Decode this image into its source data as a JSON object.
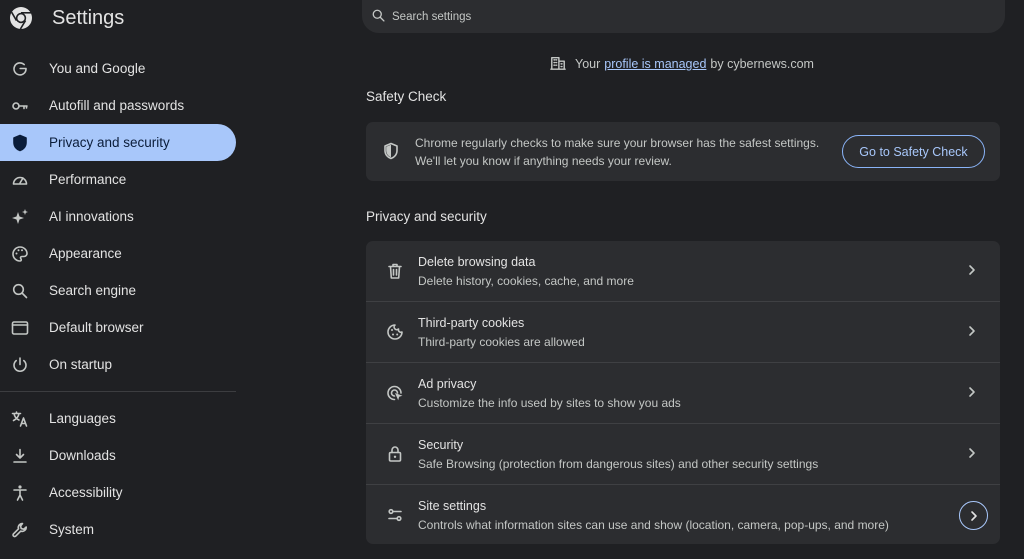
{
  "app": {
    "title": "Settings",
    "logo": "chrome-logo-icon"
  },
  "sidebar": {
    "items": [
      {
        "label": "You and Google",
        "icon": "google-g-icon",
        "active": false
      },
      {
        "label": "Autofill and passwords",
        "icon": "key-icon",
        "active": false
      },
      {
        "label": "Privacy and security",
        "icon": "shield-icon",
        "active": true
      },
      {
        "label": "Performance",
        "icon": "speedometer-icon",
        "active": false
      },
      {
        "label": "AI innovations",
        "icon": "sparkle-icon",
        "active": false
      },
      {
        "label": "Appearance",
        "icon": "palette-icon",
        "active": false
      },
      {
        "label": "Search engine",
        "icon": "search-icon",
        "active": false
      },
      {
        "label": "Default browser",
        "icon": "browser-window-icon",
        "active": false
      },
      {
        "label": "On startup",
        "icon": "power-icon",
        "active": false
      },
      {
        "label": "Languages",
        "icon": "translate-icon",
        "active": false
      },
      {
        "label": "Downloads",
        "icon": "download-icon",
        "active": false
      },
      {
        "label": "Accessibility",
        "icon": "accessibility-icon",
        "active": false
      },
      {
        "label": "System",
        "icon": "wrench-icon",
        "active": false
      }
    ]
  },
  "search": {
    "placeholder": "Search settings",
    "value": ""
  },
  "managed": {
    "prefix": "Your",
    "link": "profile is managed",
    "suffix": "by cybernews.com",
    "icon": "building-icon"
  },
  "safety_check": {
    "heading": "Safety Check",
    "text": "Chrome regularly checks to make sure your browser has the safest settings. We'll let you know if anything needs your review.",
    "button": "Go to Safety Check",
    "icon": "shield-outline-icon"
  },
  "privacy": {
    "heading": "Privacy and security",
    "rows": [
      {
        "title": "Delete browsing data",
        "subtitle": "Delete history, cookies, cache, and more",
        "icon": "trash-icon"
      },
      {
        "title": "Third-party cookies",
        "subtitle": "Third-party cookies are allowed",
        "icon": "cookie-icon"
      },
      {
        "title": "Ad privacy",
        "subtitle": "Customize the info used by sites to show you ads",
        "icon": "ad-privacy-icon"
      },
      {
        "title": "Security",
        "subtitle": "Safe Browsing (protection from dangerous sites) and other security settings",
        "icon": "lock-icon"
      },
      {
        "title": "Site settings",
        "subtitle": "Controls what information sites can use and show (location, camera, pop-ups, and more)",
        "icon": "sliders-icon"
      }
    ]
  },
  "colors": {
    "background": "#1f2023",
    "card": "#2c2d30",
    "accent": "#a8c7fa",
    "text": "#e3e3e3",
    "secondary_text": "#c4c7c5"
  }
}
